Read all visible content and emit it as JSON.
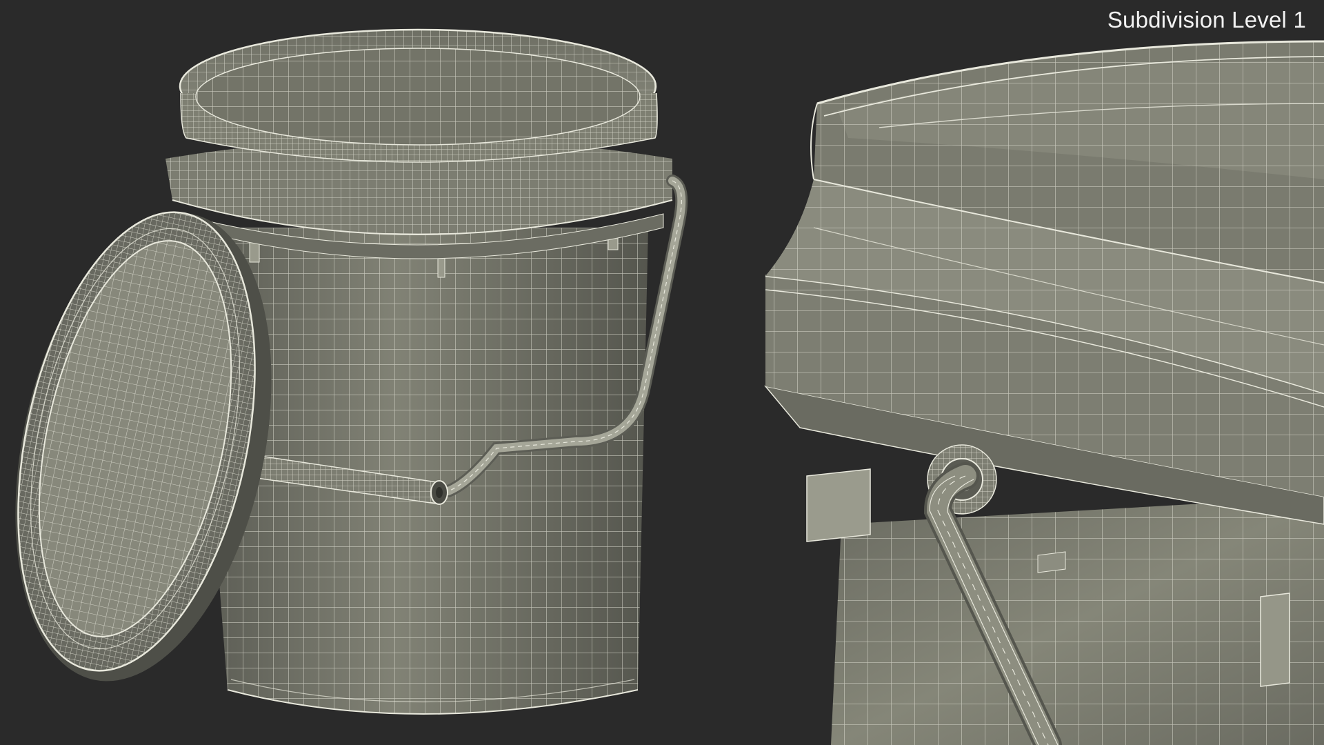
{
  "caption": {
    "label": "Subdivision Level 1"
  },
  "scene": {
    "background_color": "#2a2a2a",
    "model_surface_color": "#77786c",
    "model_shadow_color": "#4c4d46",
    "wireframe_color": "#e6e6da",
    "views": [
      {
        "name": "full-view",
        "objects": [
          "bucket-body",
          "bucket-rim",
          "bucket-handle",
          "handle-grip",
          "lid"
        ]
      },
      {
        "name": "closeup-view",
        "objects": [
          "rim-closeup",
          "handle-lug",
          "handle-wire",
          "stacking-tabs"
        ]
      }
    ]
  }
}
